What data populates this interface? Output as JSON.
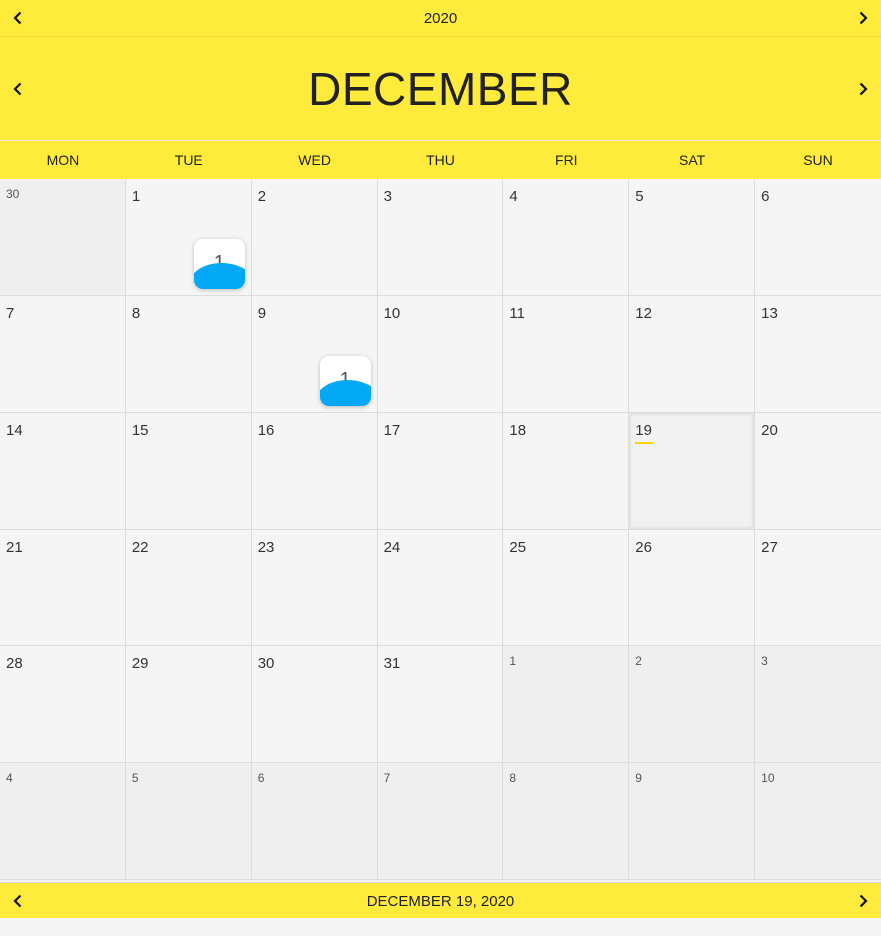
{
  "header": {
    "year": "2020",
    "month": "DECEMBER"
  },
  "weekdays": [
    "MON",
    "TUE",
    "WED",
    "THU",
    "FRI",
    "SAT",
    "SUN"
  ],
  "weeks": [
    [
      {
        "d": "30",
        "other": true
      },
      {
        "d": "1",
        "badge": "1"
      },
      {
        "d": "2"
      },
      {
        "d": "3"
      },
      {
        "d": "4"
      },
      {
        "d": "5"
      },
      {
        "d": "6"
      }
    ],
    [
      {
        "d": "7"
      },
      {
        "d": "8"
      },
      {
        "d": "9",
        "badge": "1"
      },
      {
        "d": "10"
      },
      {
        "d": "11"
      },
      {
        "d": "12"
      },
      {
        "d": "13"
      }
    ],
    [
      {
        "d": "14"
      },
      {
        "d": "15"
      },
      {
        "d": "16"
      },
      {
        "d": "17"
      },
      {
        "d": "18"
      },
      {
        "d": "19",
        "today": true
      },
      {
        "d": "20"
      }
    ],
    [
      {
        "d": "21"
      },
      {
        "d": "22"
      },
      {
        "d": "23"
      },
      {
        "d": "24"
      },
      {
        "d": "25"
      },
      {
        "d": "26"
      },
      {
        "d": "27"
      }
    ],
    [
      {
        "d": "28"
      },
      {
        "d": "29"
      },
      {
        "d": "30"
      },
      {
        "d": "31"
      },
      {
        "d": "1",
        "other": true
      },
      {
        "d": "2",
        "other": true
      },
      {
        "d": "3",
        "other": true
      }
    ],
    [
      {
        "d": "4",
        "other": true
      },
      {
        "d": "5",
        "other": true
      },
      {
        "d": "6",
        "other": true
      },
      {
        "d": "7",
        "other": true
      },
      {
        "d": "8",
        "other": true
      },
      {
        "d": "9",
        "other": true
      },
      {
        "d": "10",
        "other": true
      }
    ]
  ],
  "footer": {
    "selected_date": "DECEMBER 19, 2020"
  },
  "icons": {
    "prev": "chevron-left-icon",
    "next": "chevron-right-icon"
  },
  "colors": {
    "header_bg": "#ffeb3b",
    "badge_wave": "#03a9f4",
    "today_marker": "#ffd600"
  }
}
